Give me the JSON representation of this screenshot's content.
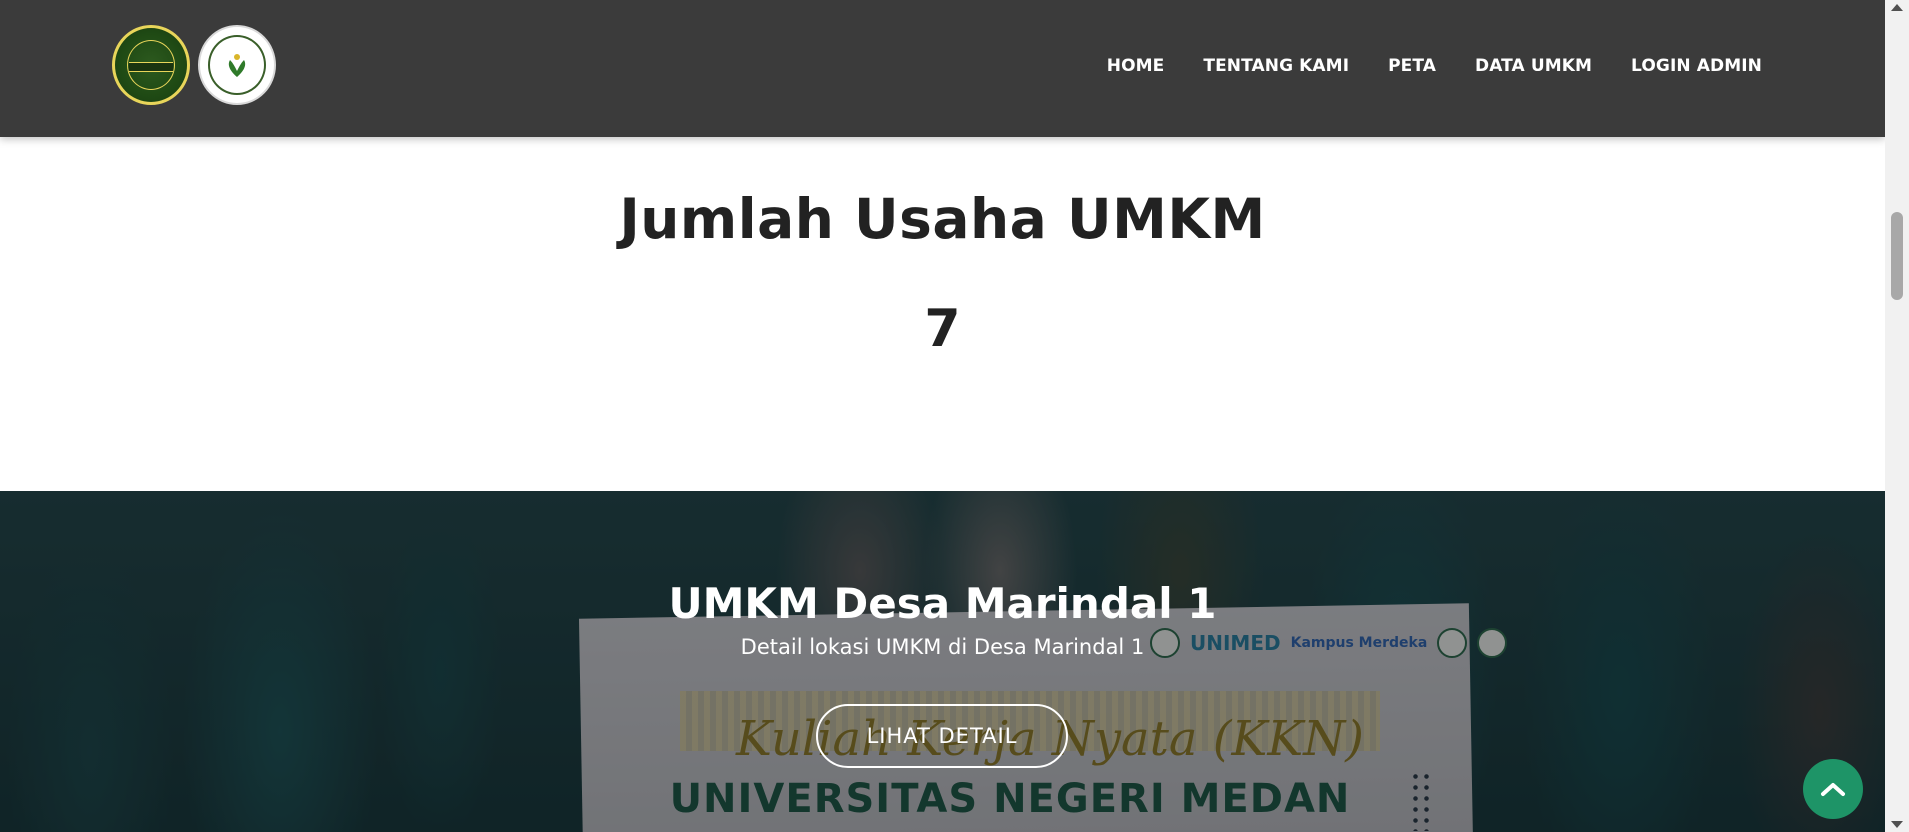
{
  "header": {
    "logos": [
      {
        "name": "desa-marindal-logo",
        "icon": "village-seal-icon"
      },
      {
        "name": "unimed-logo",
        "icon": "university-seal-icon"
      }
    ],
    "nav": [
      {
        "label": "HOME"
      },
      {
        "label": "TENTANG KAMI"
      },
      {
        "label": "PETA"
      },
      {
        "label": "DATA UMKM"
      },
      {
        "label": "LOGIN ADMIN"
      }
    ]
  },
  "counter": {
    "title": "Jumlah Usaha UMKM",
    "value": "7"
  },
  "hero": {
    "title": "UMKM Desa Marindal 1",
    "subtitle": "Detail lokasi UMKM di Desa Marindal 1",
    "button_label": "LIHAT DETAIL",
    "photo_banner": {
      "logo_text": "UNIMED",
      "kampus_text": "Kampus Merdeka",
      "line1": "Kuliah Kerja Nyata (KKN)",
      "line2": "UNIVERSITAS NEGERI MEDAN"
    }
  },
  "scroll_top": {
    "icon": "chevron-up-icon"
  },
  "colors": {
    "header_bg": "#3b3b3b",
    "accent_green": "#1e9467",
    "text_dark": "#222222"
  }
}
